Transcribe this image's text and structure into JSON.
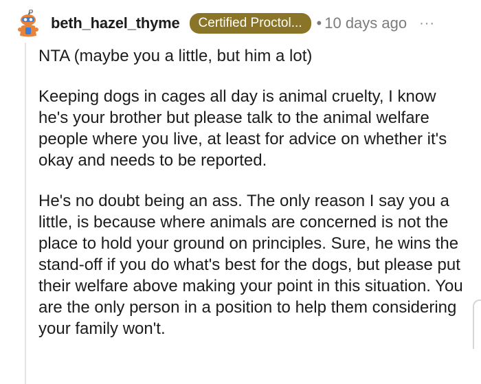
{
  "comment": {
    "author": "beth_hazel_thyme",
    "flair": "Certified Proctol...",
    "separator": "•",
    "timestamp": "10 days ago",
    "more_label": "···",
    "paragraphs": [
      "NTA (maybe you a little, but him a lot)",
      "Keeping dogs in cages all day is animal cruelty, I know he's your brother but please talk to the animal welfare people where you live, at least for advice on whether it's okay and needs to be reported.",
      "He's no doubt being an ass. The only reason I say you a little, is because where animals are concerned is not the place to hold your ground on principles. Sure, he wins the stand-off if you do what's best for the dogs, but please put their welfare above making your point in this situation. You are the only person in a position to help them considering your family won't."
    ]
  },
  "colors": {
    "flair_background": "#8a7428",
    "flair_text": "#ffffff",
    "meta_text": "#7c7c7c",
    "avatar_body": "#e8833a",
    "avatar_accent": "#3b7dd8"
  },
  "icons": {
    "avatar": "snoo-avatar-icon",
    "more": "more-options-icon"
  }
}
